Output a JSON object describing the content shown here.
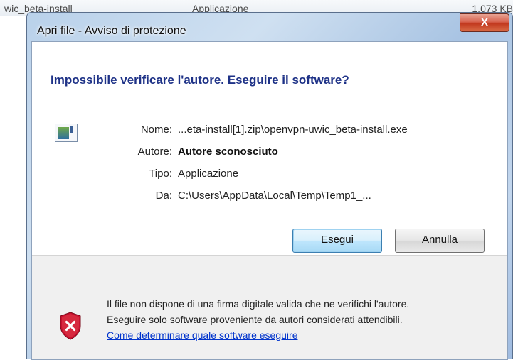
{
  "background": {
    "row_name": "wic_beta-install",
    "row_type": "Applicazione",
    "row_size": "1.073 KB"
  },
  "window": {
    "title": "Apri file - Avviso di protezione",
    "close_label": "X"
  },
  "dialog": {
    "heading": "Impossibile verificare l'autore. Eseguire il software?",
    "file_icon": "application-file-icon",
    "fields": [
      {
        "label": "Nome:",
        "value": "...eta-install[1].zip\\openvpn-uwic_beta-install.exe"
      },
      {
        "label": "Autore:",
        "value": "Autore sconosciuto"
      },
      {
        "label": "Tipo:",
        "value": "Applicazione"
      },
      {
        "label": "Da:",
        "value": "C:\\Users\\AppData\\Local\\Temp\\Temp1_..."
      }
    ],
    "buttons": {
      "run": "Esegui",
      "cancel": "Annulla"
    },
    "warning": {
      "icon": "shield-error-icon",
      "line1": "Il file non dispone di una firma digitale valida che ne verifichi l'autore.",
      "line2": "Eseguire solo software proveniente da autori considerati attendibili.",
      "link": "Come determinare quale software eseguire"
    }
  },
  "colors": {
    "heading": "#1e3287",
    "link": "#0033cc",
    "close_button": "#c2391f",
    "shield_red": "#c8102e"
  }
}
